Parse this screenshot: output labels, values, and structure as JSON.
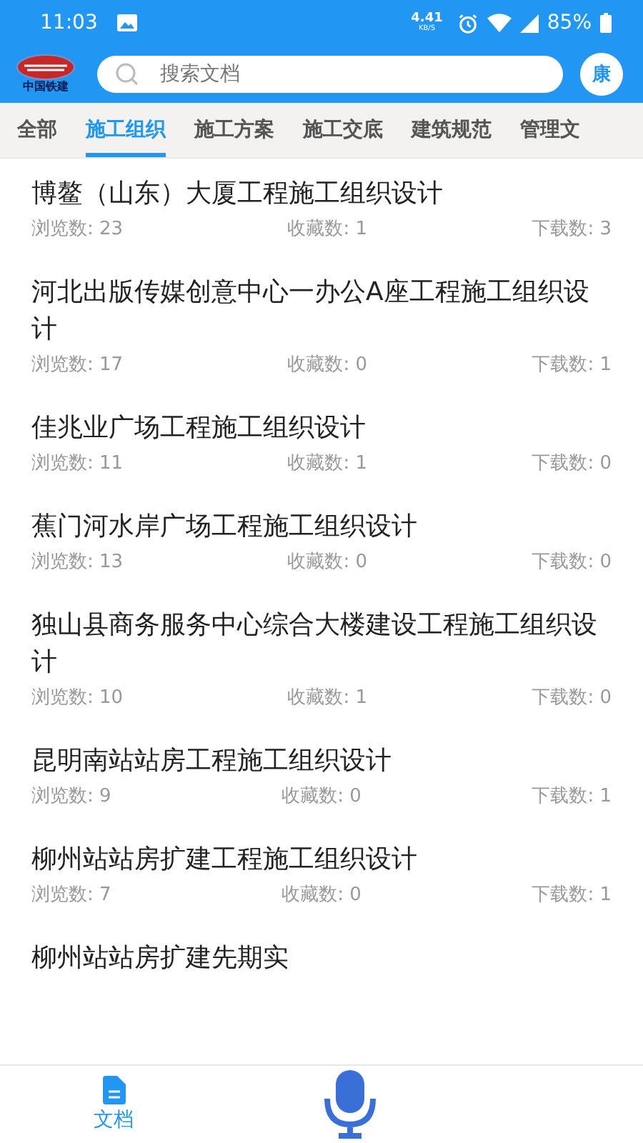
{
  "status_bar": {
    "time": "11:03",
    "speed_value": "4.41",
    "speed_unit": "KB/S",
    "battery": "85%"
  },
  "header": {
    "logo_text": "中国铁建",
    "search": {
      "placeholder": "搜索文档"
    },
    "avatar": "康"
  },
  "tabs": [
    {
      "label": "全部",
      "selected": false
    },
    {
      "label": "施工组织",
      "selected": true
    },
    {
      "label": "施工方案",
      "selected": false
    },
    {
      "label": "施工交底",
      "selected": false
    },
    {
      "label": "建筑规范",
      "selected": false
    },
    {
      "label": "管理文",
      "selected": false
    }
  ],
  "documents": [
    {
      "title": "博鳌（山东）大厦工程施工组织设计",
      "views": "浏览数: 23",
      "favorites": "收藏数: 1",
      "downloads": "下载数: 3"
    },
    {
      "title": "河北出版传媒创意中心一办公A座工程施工组织设计",
      "views": "浏览数: 17",
      "favorites": "收藏数: 0",
      "downloads": "下载数: 1"
    },
    {
      "title": "佳兆业广场工程施工组织设计",
      "views": "浏览数: 11",
      "favorites": "收藏数: 1",
      "downloads": "下载数: 0"
    },
    {
      "title": "蕉门河水岸广场工程施工组织设计",
      "views": "浏览数: 13",
      "favorites": "收藏数: 0",
      "downloads": "下载数: 0"
    },
    {
      "title": "独山县商务服务中心综合大楼建设工程施工组织设计",
      "views": "浏览数: 10",
      "favorites": "收藏数: 1",
      "downloads": "下载数: 0"
    },
    {
      "title": "昆明南站站房工程施工组织设计",
      "views": "浏览数: 9",
      "favorites": "收藏数: 0",
      "downloads": "下载数: 1"
    },
    {
      "title": "柳州站站房扩建工程施工组织设计",
      "views": "浏览数: 7",
      "favorites": "收藏数: 0",
      "downloads": "下载数: 1"
    },
    {
      "title": "柳州站站房扩建先期实"
    }
  ],
  "bottom_nav": [
    {
      "kind": "document",
      "label": "文档",
      "selected": true
    },
    {
      "kind": "microphone",
      "selected": false
    }
  ]
}
